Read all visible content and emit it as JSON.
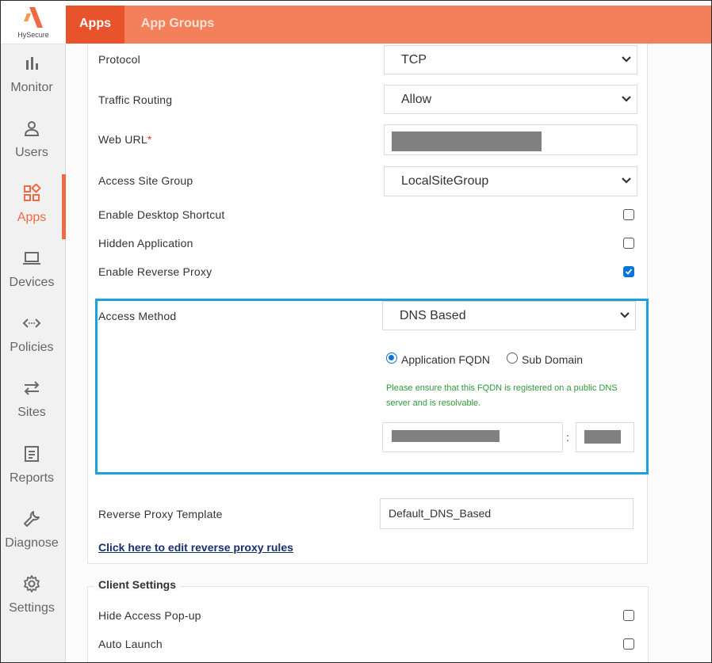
{
  "brand": {
    "name": "HySecure",
    "logo_icon": "hysecure-logo-icon",
    "accent": "#ef6a44"
  },
  "header": {
    "tabs": [
      {
        "label": "Apps",
        "active": true
      },
      {
        "label": "App Groups",
        "active": false
      }
    ]
  },
  "sidebar": {
    "items": [
      {
        "label": "Monitor",
        "icon": "bar-chart-icon"
      },
      {
        "label": "Users",
        "icon": "user-icon"
      },
      {
        "label": "Apps",
        "icon": "apps-grid-icon",
        "active": true
      },
      {
        "label": "Devices",
        "icon": "laptop-icon"
      },
      {
        "label": "Policies",
        "icon": "code-arrows-icon"
      },
      {
        "label": "Sites",
        "icon": "swap-arrows-icon"
      },
      {
        "label": "Reports",
        "icon": "report-icon"
      },
      {
        "label": "Diagnose",
        "icon": "wrench-icon"
      },
      {
        "label": "Settings",
        "icon": "gear-icon"
      }
    ]
  },
  "form": {
    "protocol": {
      "label": "Protocol",
      "value": "TCP"
    },
    "traffic_routing": {
      "label": "Traffic Routing",
      "value": "Allow"
    },
    "web_url": {
      "label": "Web URL",
      "required_mark": "*",
      "value": ""
    },
    "access_site_group": {
      "label": "Access Site Group",
      "value": "LocalSiteGroup"
    },
    "enable_desktop_shortcut": {
      "label": "Enable Desktop Shortcut",
      "checked": false
    },
    "hidden_application": {
      "label": "Hidden Application",
      "checked": false
    },
    "enable_reverse_proxy": {
      "label": "Enable Reverse Proxy",
      "checked": true
    },
    "access_method": {
      "label": "Access Method",
      "value": "DNS Based",
      "options": [
        {
          "label": "Application FQDN",
          "selected": true
        },
        {
          "label": "Sub Domain",
          "selected": false
        }
      ],
      "hint": "Please ensure that this FQDN is registered on a public DNS server and is resolvable.",
      "separator": ":"
    },
    "reverse_proxy_template": {
      "label": "Reverse Proxy Template",
      "value": "Default_DNS_Based"
    },
    "edit_rules_link": "Click here to edit reverse proxy rules"
  },
  "client_settings": {
    "title": "Client Settings",
    "hide_access_popup": {
      "label": "Hide Access Pop-up",
      "checked": false
    },
    "auto_launch": {
      "label": "Auto Launch",
      "checked": false
    }
  },
  "colors": {
    "header": "#f47f5b",
    "active_tab": "#e9532c",
    "highlight_border": "#1aa1de",
    "checkbox_checked": "#0b74d6",
    "hint_text": "#2f9a3a"
  }
}
